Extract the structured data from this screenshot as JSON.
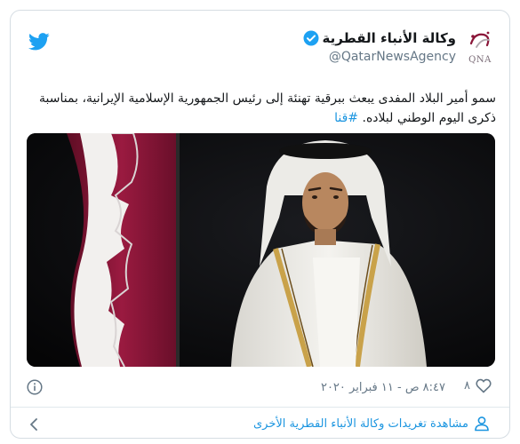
{
  "tweet": {
    "author_name": "وكالة الأنباء القطرية",
    "author_handle": "@QatarNewsAgency",
    "avatar_text": "QNA",
    "text": "سمو أمير البلاد المفدى يبعث ببرقية تهنئة إلى رئيس الجمهورية الإسلامية الإيرانية، بمناسبة ذكرى اليوم الوطني لبلاده.",
    "hashtag": "#قنا",
    "like_count": "٨",
    "timestamp": "٨:٤٧ ص - ١١ فبراير ٢٠٢٠"
  },
  "footer": {
    "more_label": "مشاهدة تغريدات وكالة الأنباء القطرية الأخرى"
  },
  "icons": {
    "brand": "twitter-icon",
    "verified": "verified-icon",
    "like": "heart-icon",
    "info": "info-icon",
    "back": "chevron-left-icon",
    "person": "person-icon"
  },
  "colors": {
    "link_blue": "#1b95e0",
    "twitter_blue": "#1da1f2",
    "muted": "#657786",
    "flag_maroon": "#8a1538"
  }
}
